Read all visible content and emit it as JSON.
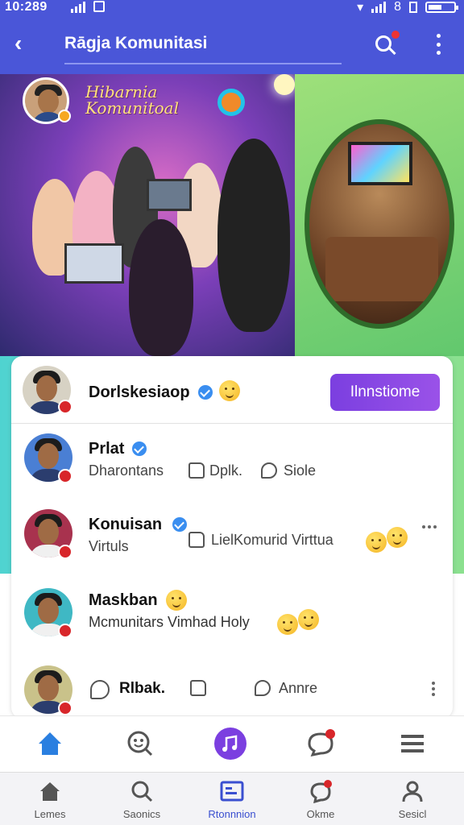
{
  "status_bar": {
    "time": "10:289"
  },
  "header": {
    "title": "Rāgja Komunitasi"
  },
  "banner": {
    "title_line1": "Hibarnia",
    "title_line2": "Komunitoal"
  },
  "feed": [
    {
      "name": "Dorlskesiaop",
      "button_label": "Ilnnstiome"
    },
    {
      "name": "Prlat",
      "subtitle": "Dharontans",
      "like_label": "Dplk.",
      "comment_label": "Siole"
    },
    {
      "name": "Konuisan",
      "subtitle": "Virtuls",
      "like_label": "LielKomurid Virttua"
    },
    {
      "name": "Maskban",
      "subtitle": "Mcmunitars Vimhad Holy"
    },
    {
      "like_label": "Rlbak.",
      "comment_label": "Annre"
    }
  ],
  "tabbar_top": [
    {
      "icon": "home-icon",
      "active": true
    },
    {
      "icon": "face-search-icon"
    },
    {
      "icon": "music-note-icon"
    },
    {
      "icon": "chat-bubble-icon",
      "badge": true
    },
    {
      "icon": "menu-icon"
    }
  ],
  "tabbar_bottom": [
    {
      "icon": "home-icon",
      "label": "Lemes"
    },
    {
      "icon": "search-icon",
      "label": "Saonics"
    },
    {
      "icon": "community-icon",
      "label": "Rtonnnion",
      "active": true
    },
    {
      "icon": "notifications-icon",
      "label": "Okme"
    },
    {
      "icon": "profile-icon",
      "label": "Sesicl"
    }
  ],
  "colors": {
    "appbar": "#4a56d8",
    "accent": "#7b3fe0",
    "badge": "#d8262a",
    "verified": "#3a8ef0"
  }
}
